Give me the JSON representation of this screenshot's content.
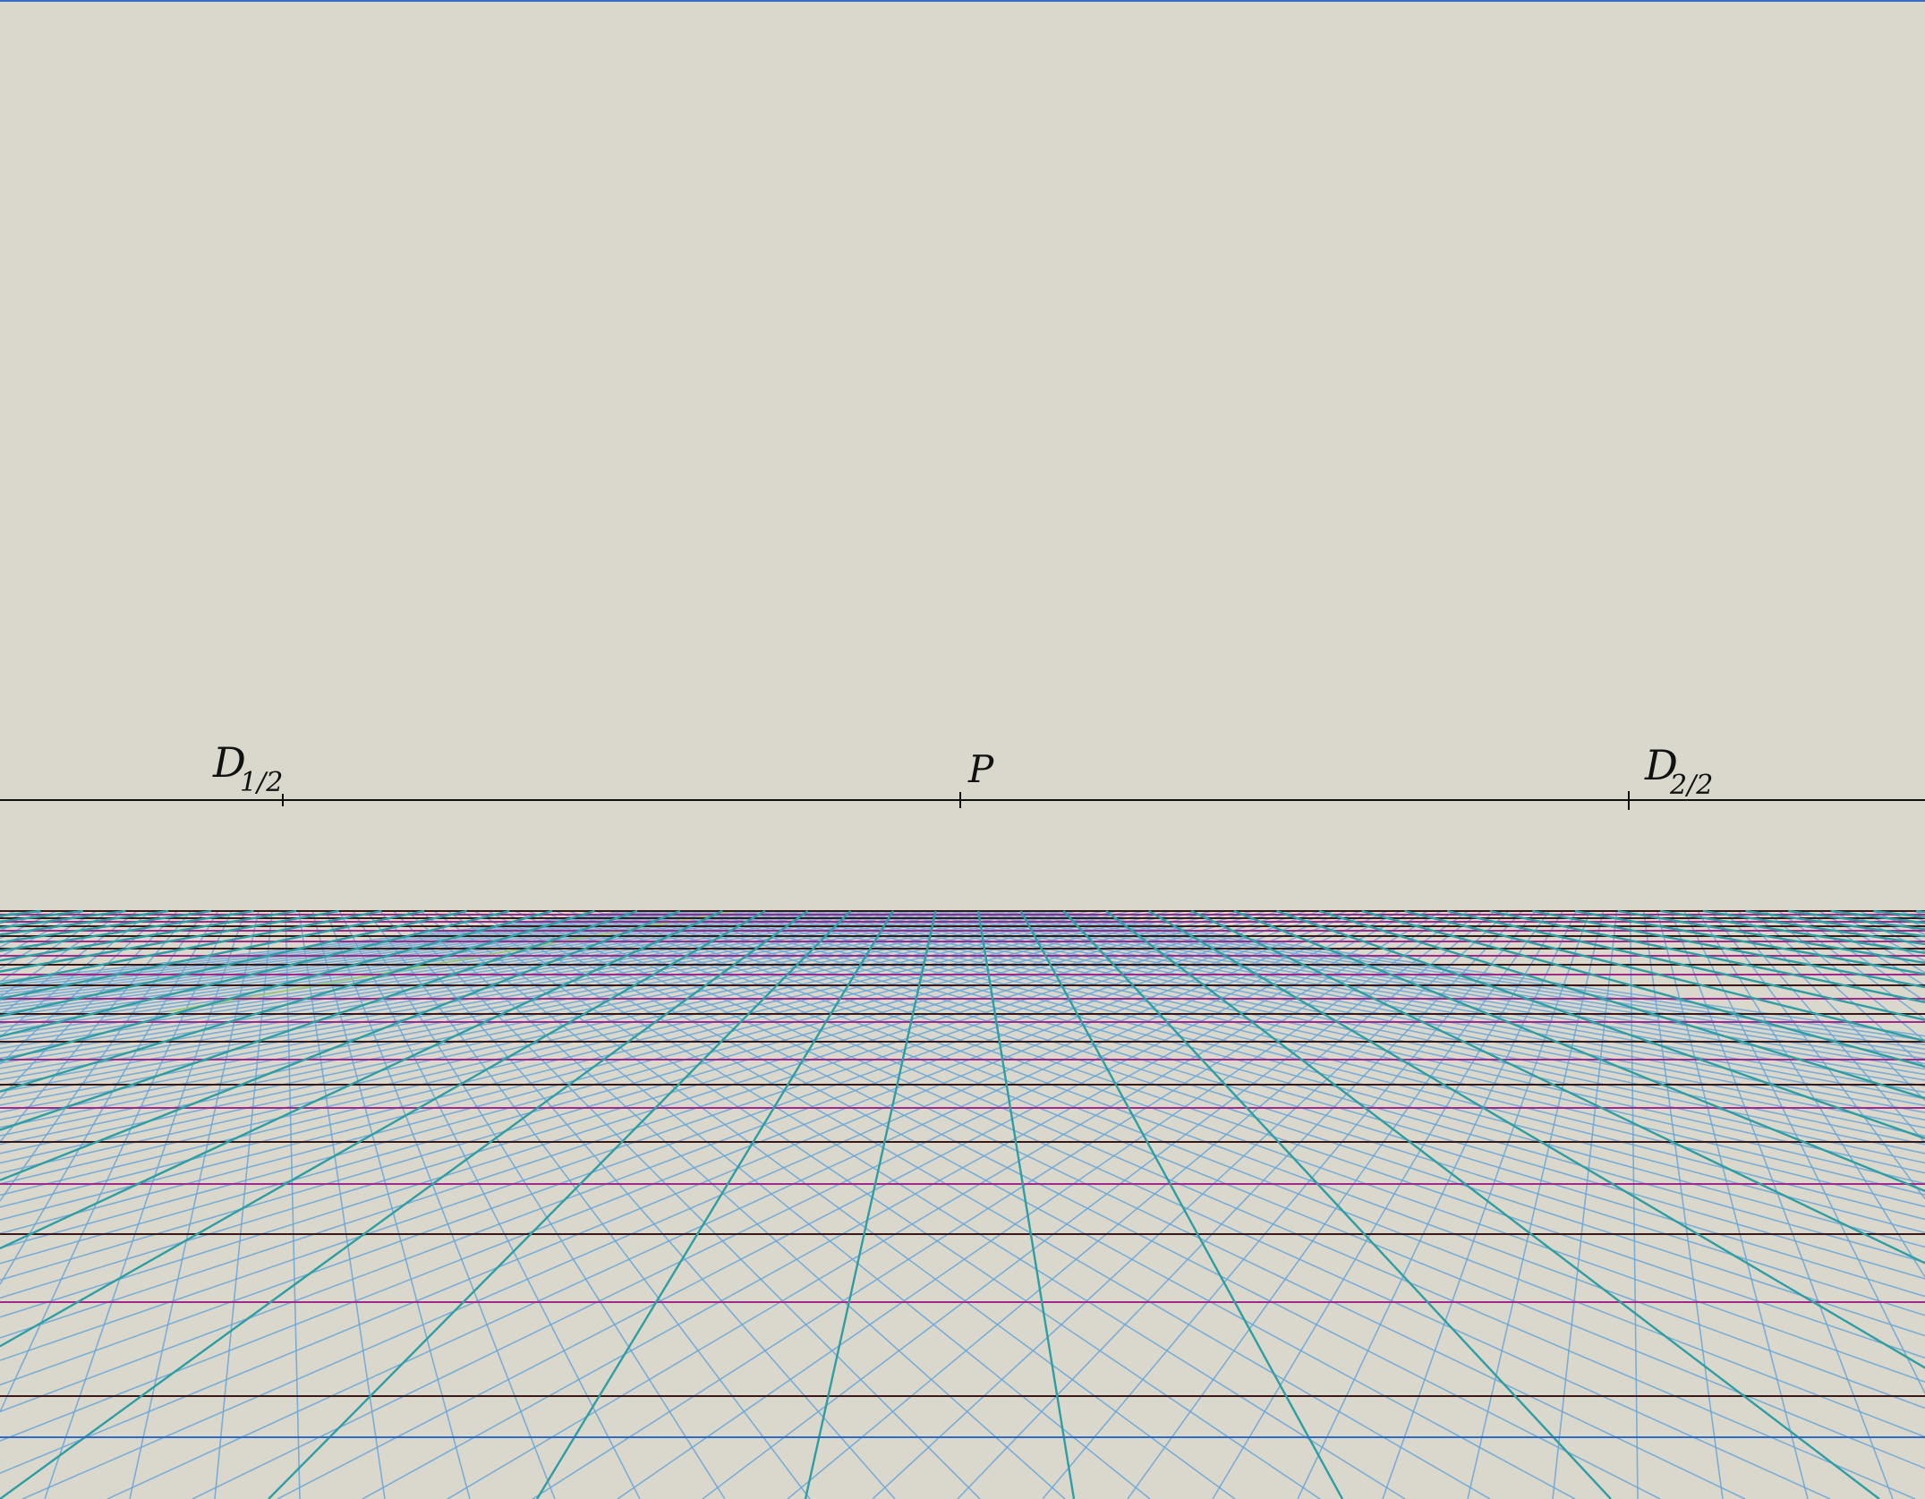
{
  "diagram": {
    "title": "",
    "background_color": "#dad8cc",
    "horizon": {
      "line_color": "#111111"
    },
    "points": [
      {
        "id": "d1",
        "label": "D",
        "subscript": "1/2",
        "marker": "cross-icon"
      },
      {
        "id": "p",
        "label": "P",
        "subscript": "",
        "marker": "cross-icon"
      },
      {
        "id": "d2",
        "label": "D",
        "subscript": "2/2",
        "marker": "cross-icon"
      }
    ],
    "colors": {
      "orthogonals": "#2e9ea3",
      "diagonals": "#6aa6d6",
      "transversal_dark": "#3a1818",
      "transversal_magenta": "#a02a8a",
      "top_border": "#3a6cc4",
      "bottom_border": "#2f6cc0",
      "faint_green": "#9cc878"
    }
  }
}
